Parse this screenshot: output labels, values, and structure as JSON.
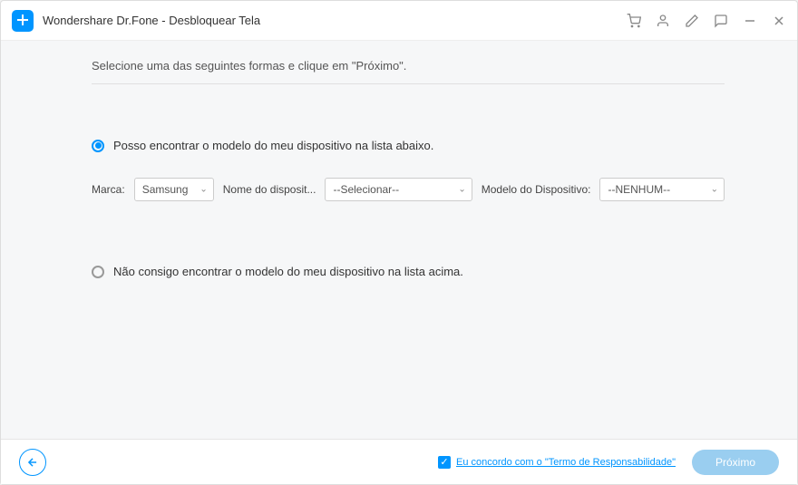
{
  "titlebar": {
    "app_title": "Wondershare Dr.Fone - Desbloquear Tela"
  },
  "content": {
    "instruction_text": "Selecione uma das seguintes formas e clique em \"Próximo\".",
    "option1_label": "Posso encontrar o modelo do meu dispositivo na lista abaixo.",
    "option2_label": "Não consigo encontrar o modelo do meu dispositivo na lista acima.",
    "form": {
      "brand_label": "Marca:",
      "brand_value": "Samsung",
      "device_name_label": "Nome do disposit...",
      "device_name_value": "--Selecionar--",
      "device_model_label": "Modelo do Dispositivo:",
      "device_model_value": "--NENHUM--"
    }
  },
  "footer": {
    "agreement_text": "Eu concordo com o \"Termo de Responsabilidade\"",
    "next_button": "Próximo"
  }
}
